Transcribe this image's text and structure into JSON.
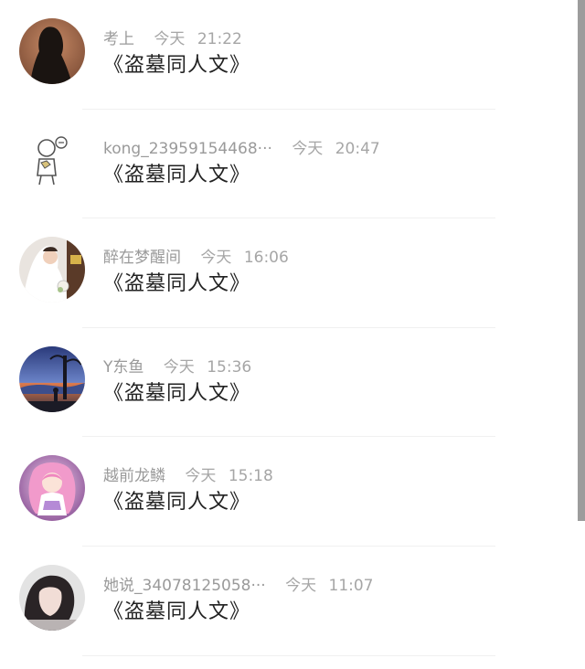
{
  "comments": [
    {
      "name": "考上",
      "date": "今天",
      "time": "21:22",
      "text": "《盗墓同人文》",
      "avatar_icon": "silhouette-avatar"
    },
    {
      "name": "kong_23959154468···",
      "date": "今天",
      "time": "20:47",
      "text": "《盗墓同人文》",
      "avatar_icon": "sketch-figure-avatar"
    },
    {
      "name": "醉在梦醒间",
      "date": "今天",
      "time": "16:06",
      "text": "《盗墓同人文》",
      "avatar_icon": "bride-photo-avatar"
    },
    {
      "name": "Y东鱼",
      "date": "今天",
      "time": "15:36",
      "text": "《盗墓同人文》",
      "avatar_icon": "night-scene-avatar"
    },
    {
      "name": "越前龙鳞",
      "date": "今天",
      "time": "15:18",
      "text": "《盗墓同人文》",
      "avatar_icon": "anime-girl-avatar"
    },
    {
      "name": "她说_34078125058···",
      "date": "今天",
      "time": "11:07",
      "text": "《盗墓同人文》",
      "avatar_icon": "girl-photo-avatar"
    }
  ],
  "colors": {
    "name_text": "#9a9a9a",
    "meta_text": "#a6a6a6",
    "content_text": "#222222",
    "divider": "#f0f0f0",
    "scrollbar": "#9c9c9c"
  }
}
